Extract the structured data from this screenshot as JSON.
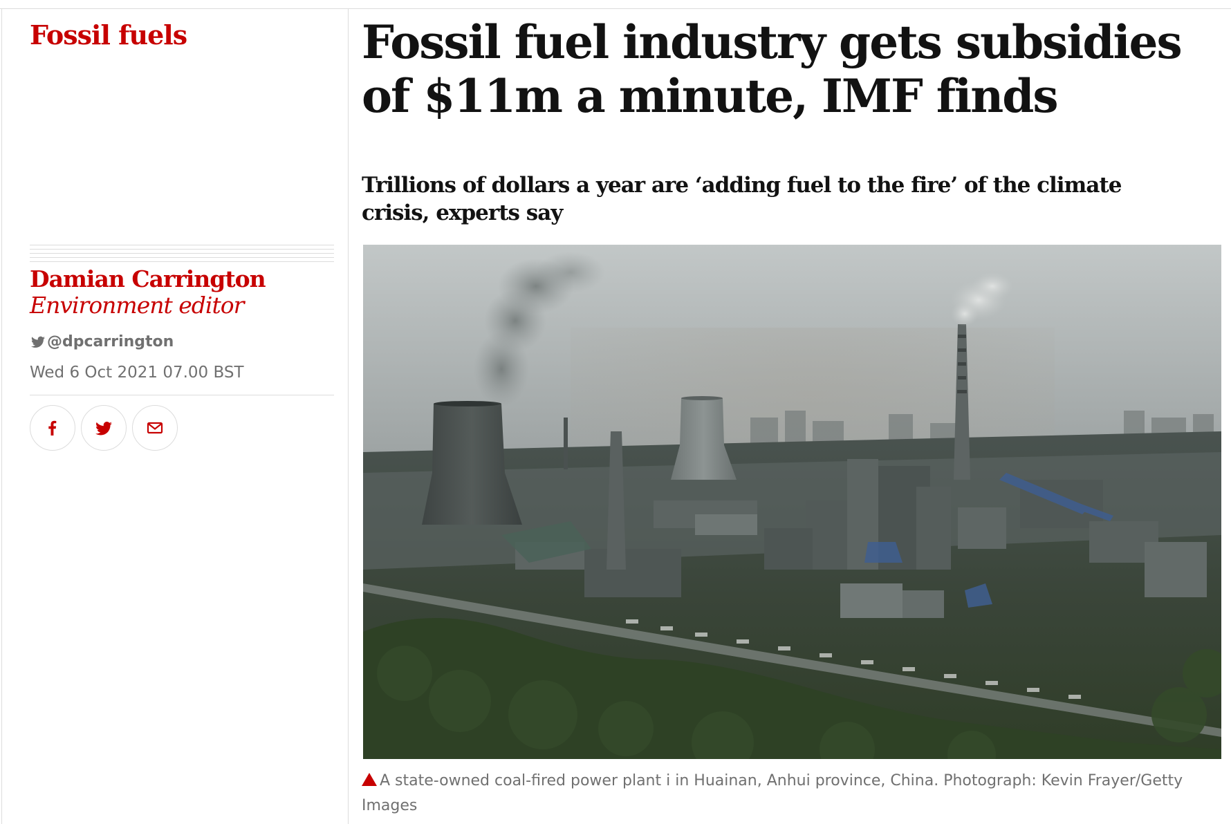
{
  "section": {
    "label": "Fossil fuels"
  },
  "byline": {
    "author": "Damian Carrington",
    "role": "Environment editor",
    "twitter_handle": "@dpcarrington",
    "date": "Wed 6 Oct 2021 07.00 BST"
  },
  "share": {
    "buttons": [
      {
        "icon": "facebook-icon"
      },
      {
        "icon": "twitter-icon"
      },
      {
        "icon": "email-icon"
      }
    ]
  },
  "article": {
    "headline": "Fossil fuel industry gets subsidies of $11m a minute, IMF finds",
    "standfirst": "Trillions of dollars a year are ‘adding fuel to the fire’ of the climate crisis, experts say",
    "caption": "A state-owned coal-fired power plant i in Huainan, Anhui province, China. Photograph: Kevin Frayer/Getty Images"
  },
  "colors": {
    "accent": "#c70000",
    "text": "#121212",
    "muted": "#707070",
    "rule": "#dcdcdc"
  }
}
